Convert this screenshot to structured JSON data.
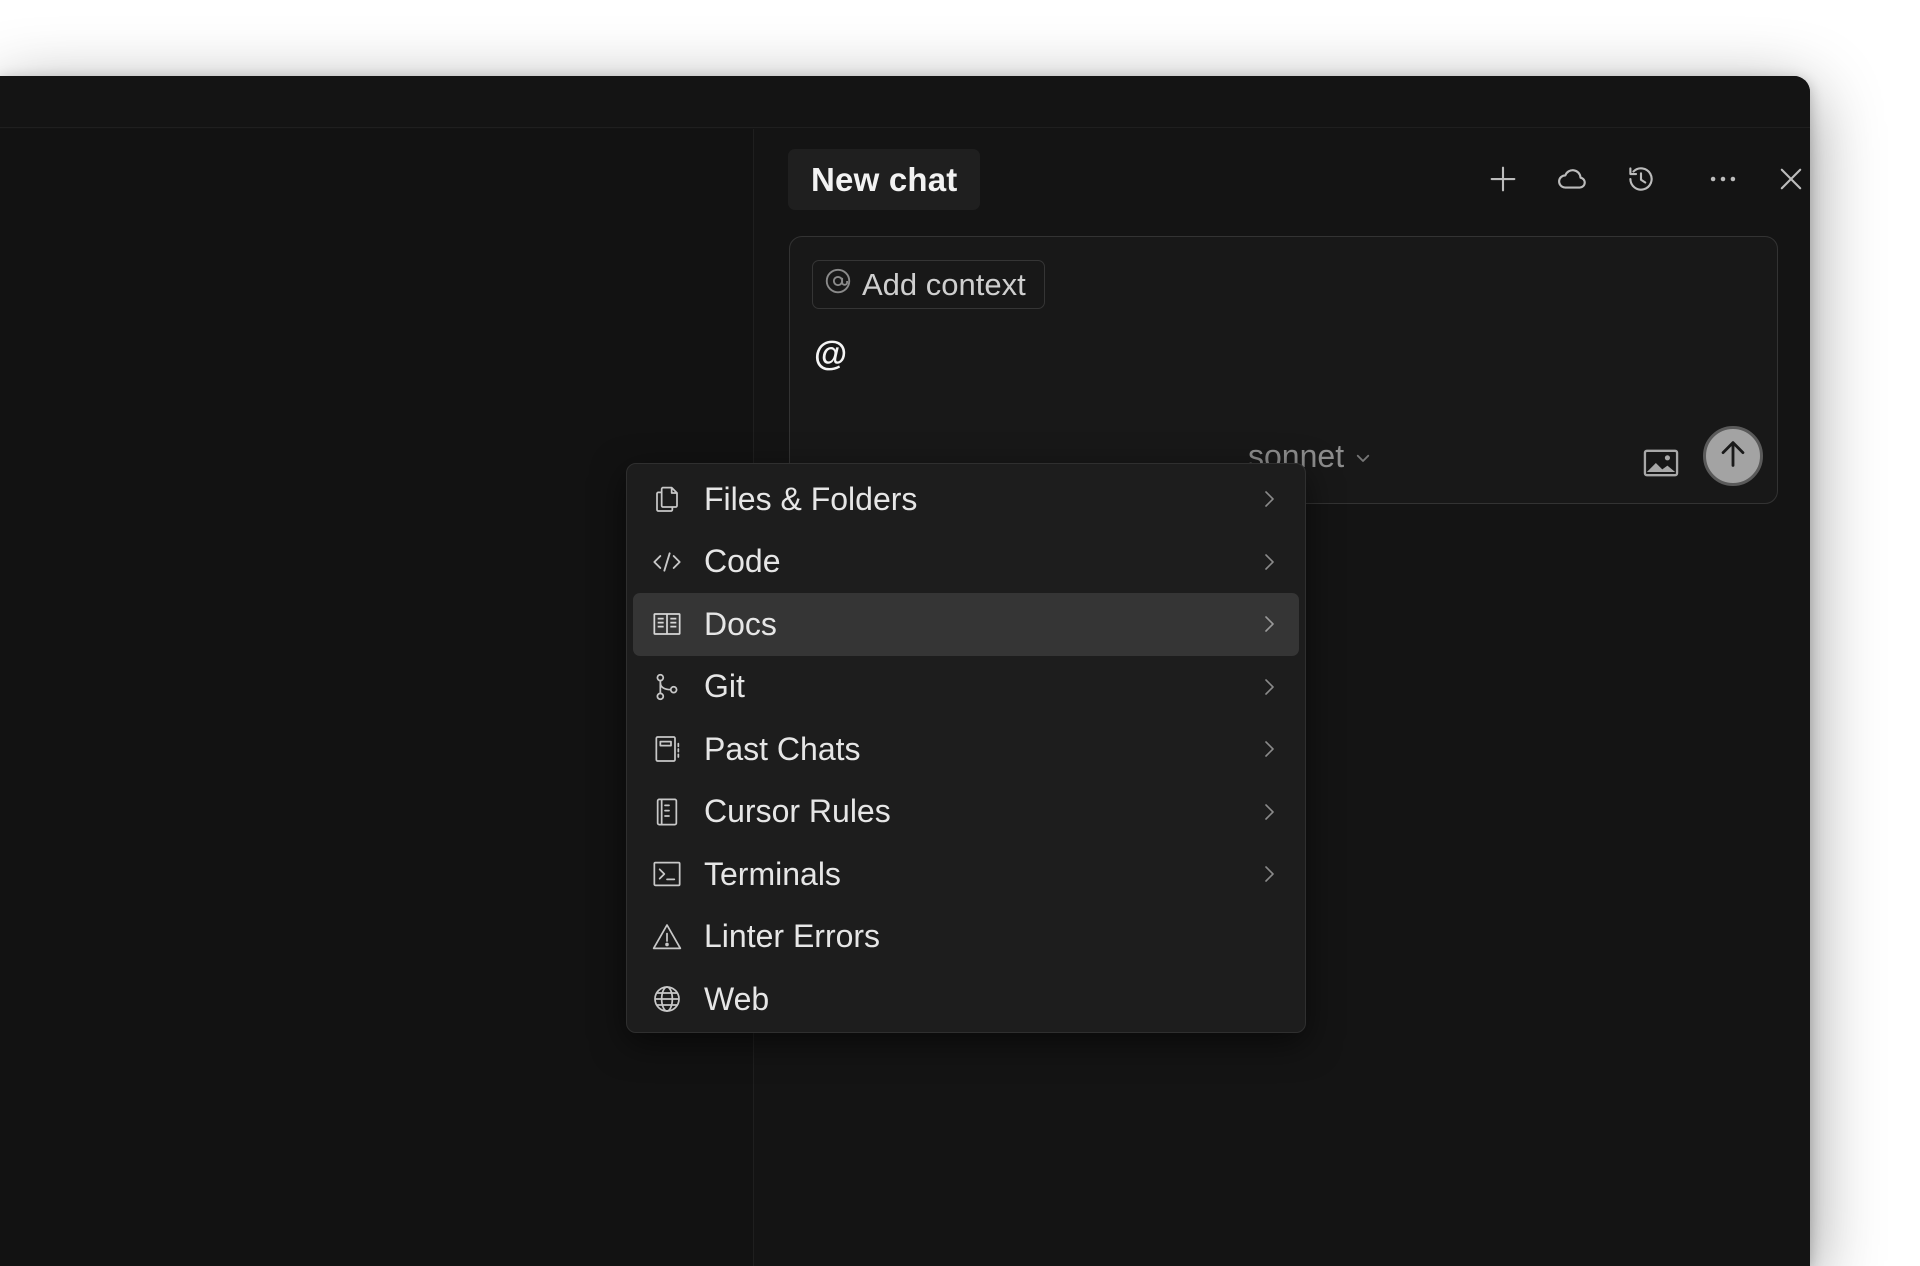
{
  "chat": {
    "tab_title": "New chat",
    "header_icons": [
      "plus-icon",
      "cloud-icon",
      "history-icon",
      "more-icon",
      "close-icon"
    ]
  },
  "composer": {
    "add_context_label": "Add context",
    "typed_text": "@",
    "model_label_visible": "sonnet"
  },
  "menu": {
    "active_index": 2,
    "items": [
      {
        "label": "Files & Folders",
        "icon": "files-icon",
        "has_submenu": true
      },
      {
        "label": "Code",
        "icon": "code-icon",
        "has_submenu": true
      },
      {
        "label": "Docs",
        "icon": "book-icon",
        "has_submenu": true
      },
      {
        "label": "Git",
        "icon": "git-branch-icon",
        "has_submenu": true
      },
      {
        "label": "Past Chats",
        "icon": "notebook-icon",
        "has_submenu": true
      },
      {
        "label": "Cursor Rules",
        "icon": "rules-icon",
        "has_submenu": true
      },
      {
        "label": "Terminals",
        "icon": "terminal-icon",
        "has_submenu": true
      },
      {
        "label": "Linter Errors",
        "icon": "warning-icon",
        "has_submenu": false
      },
      {
        "label": "Web",
        "icon": "globe-icon",
        "has_submenu": false
      }
    ]
  },
  "colors": {
    "background": "#141414",
    "menu_bg": "#1d1d1d",
    "menu_active": "#353535",
    "text": "#e6e6e6",
    "send_button": "#a3a3a3"
  }
}
